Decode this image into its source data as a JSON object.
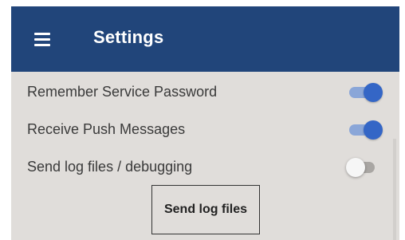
{
  "header": {
    "title": "Settings",
    "menu_icon": "hamburger-menu-icon"
  },
  "settings": {
    "remember_password": {
      "label": "Remember Service Password",
      "enabled": true
    },
    "receive_push": {
      "label": "Receive Push Messages",
      "enabled": true
    },
    "send_logs": {
      "label": "Send log files / debugging",
      "enabled": false
    }
  },
  "actions": {
    "send_log_files_label": "Send log files"
  },
  "colors": {
    "app_bar": "#21457a",
    "background": "#e0ddda",
    "switch_on_thumb": "#3466c6",
    "switch_on_track": "#8aa6d8",
    "switch_off_thumb": "#f6f6f6",
    "switch_off_track": "#a9a6a3"
  }
}
